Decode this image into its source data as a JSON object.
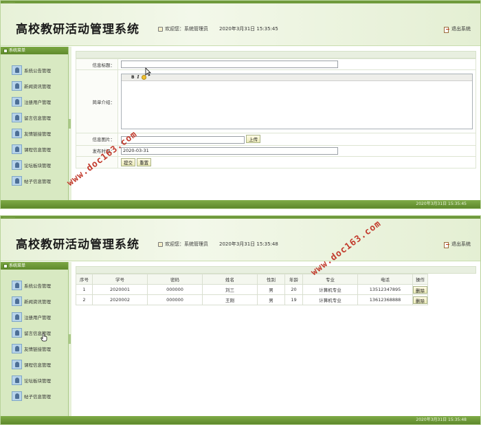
{
  "app": {
    "topstrip": "..................",
    "title": "高校教研活动管理系统",
    "welcome": "欢迎您：系统管理员",
    "logout": "退出系统",
    "sidebar_header": "系统菜单",
    "sidebar_items": [
      "系统公告管理",
      "新闻资讯管理",
      "注册用户管理",
      "留言信息管理",
      "友情链接管理",
      "课程信息管理",
      "论坛板块管理",
      "帖子信息管理"
    ]
  },
  "screen1": {
    "datetime": "2020年3月31日  15:35:45",
    "footer": "2020年3月31日  15:35:45",
    "form": {
      "title_label": "信息标题：",
      "title_value": "",
      "intro_label": "简单介绍：",
      "editor_bold": "B",
      "editor_italic": "I",
      "image_label": "信息图片：",
      "image_value": "",
      "upload_button": "上传",
      "time_label": "发布时间：",
      "time_value": "2020-03-31",
      "submit_button": "提交",
      "reset_button": "重置"
    }
  },
  "screen2": {
    "datetime": "2020年3月31日  15:35:48",
    "footer": "2020年3月31日  15:35:48",
    "table": {
      "headers": [
        "序号",
        "学号",
        "密码",
        "姓名",
        "性别",
        "年龄",
        "专业",
        "电话",
        "操作"
      ],
      "rows": [
        [
          "1",
          "2020001",
          "000000",
          "刘三",
          "男",
          "20",
          "计算机专业",
          "13512347895",
          "删除"
        ],
        [
          "2",
          "2020002",
          "000000",
          "王刚",
          "男",
          "19",
          "计算机专业",
          "13612368888",
          "删除"
        ]
      ]
    }
  },
  "watermark": "www.doc163.com",
  "colors": {
    "accent_green": "#6f9a3c",
    "sidebar_bg": "#d8e9c2",
    "watermark_red": "#c23a2c"
  },
  "icons": {
    "welcome": "user-icon",
    "logout": "exit-icon",
    "menu": "user-card-icon"
  }
}
